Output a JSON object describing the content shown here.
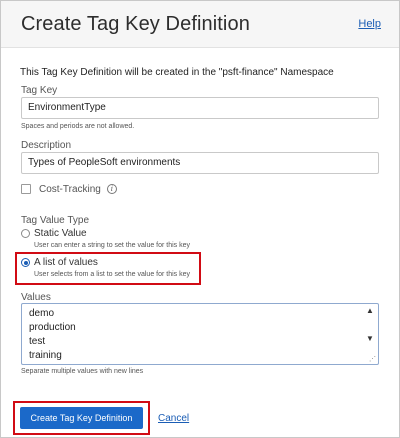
{
  "dialog": {
    "title": "Create Tag Key Definition",
    "help_link": "Help",
    "intro_text": "This Tag Key Definition will be created in the \"psft-finance\" Namespace"
  },
  "tag_key": {
    "label": "Tag Key",
    "value": "EnvironmentType",
    "hint": "Spaces and periods are not allowed."
  },
  "description": {
    "label": "Description",
    "value": "Types of PeopleSoft environments"
  },
  "cost_tracking": {
    "label": "Cost-Tracking",
    "checked": false,
    "info_icon": "info-icon"
  },
  "tag_value_type": {
    "label": "Tag Value Type",
    "options": [
      {
        "label": "Static Value",
        "hint": "User can enter a string to set the value for this key",
        "selected": false
      },
      {
        "label": "A list of values",
        "hint": "User selects from a list to set the value for this key",
        "selected": true
      }
    ]
  },
  "values": {
    "label": "Values",
    "lines": [
      "demo",
      "production",
      "test",
      "training"
    ],
    "hint": "Separate multiple values with new lines"
  },
  "footer": {
    "create_label": "Create Tag Key Definition",
    "cancel_label": "Cancel"
  },
  "colors": {
    "primary": "#1b69c9",
    "link": "#1a5db5",
    "highlight_box": "#d10b14"
  }
}
